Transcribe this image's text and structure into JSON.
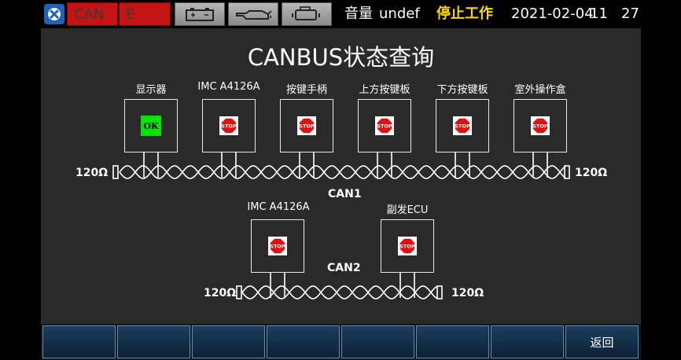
{
  "status_bar": {
    "can_alarm": "CAN",
    "e_alarm": "E",
    "indicators": [
      "battery-icon",
      "oil-pressure-icon",
      "engine-icon"
    ],
    "volume_label": "音量",
    "volume_value": "undef",
    "machine_state": "停止工作",
    "date": "2021-02-04",
    "hour": "11",
    "minute": "27"
  },
  "page": {
    "title": "CANBUS状态查询"
  },
  "can1": {
    "label": "CAN1",
    "terminator_left": "120Ω",
    "terminator_right": "120Ω",
    "nodes": [
      {
        "name": "显示器",
        "status": "OK"
      },
      {
        "name": "IMC A4126A",
        "status": "STOP"
      },
      {
        "name": "按键手柄",
        "status": "STOP"
      },
      {
        "name": "上方按键板",
        "status": "STOP"
      },
      {
        "name": "下方按键板",
        "status": "STOP"
      },
      {
        "name": "室外操作盒",
        "status": "STOP"
      }
    ]
  },
  "can2": {
    "label": "CAN2",
    "terminator_left": "120Ω",
    "terminator_right": "120Ω",
    "nodes": [
      {
        "name": "IMC A4126A",
        "status": "STOP"
      },
      {
        "name": "副发ECU",
        "status": "STOP"
      }
    ]
  },
  "bottom_bar": {
    "buttons": [
      "",
      "",
      "",
      "",
      "",
      "",
      "",
      "返回"
    ]
  },
  "colors": {
    "background": "#2a2a2a",
    "ok": "#00e600",
    "stop": "#e01010",
    "alarm": "#c41414",
    "state_text": "#ffd800"
  }
}
